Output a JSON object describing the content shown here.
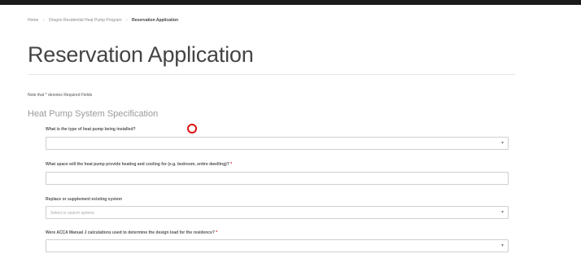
{
  "breadcrumb": {
    "home": "Home",
    "program": "Oregon Residential Heat Pump Program",
    "current": "Reservation Application"
  },
  "page": {
    "title": "Reservation Application",
    "required_note": "Note that * denotes Required Fields"
  },
  "section": {
    "heading": "Heat Pump System Specification"
  },
  "fields": [
    {
      "label": "What is the type of heat pump being installed?",
      "required": "",
      "placeholder": ""
    },
    {
      "label": "What space will the heat pump provide heating and cooling for (e.g. bedroom, entire dwelling)?",
      "required": "*",
      "placeholder": ""
    },
    {
      "label": "Replace or supplement existing system",
      "required": "",
      "placeholder": "Select or search options"
    },
    {
      "label": "Were ACCA Manual J calculations used to determine the design load for the residence?",
      "required": "*",
      "placeholder": ""
    }
  ],
  "colors": {
    "annotation": "#d11",
    "topbar": "#1a1a1a"
  },
  "icons": {
    "dropdown": "chevron-down-icon"
  }
}
